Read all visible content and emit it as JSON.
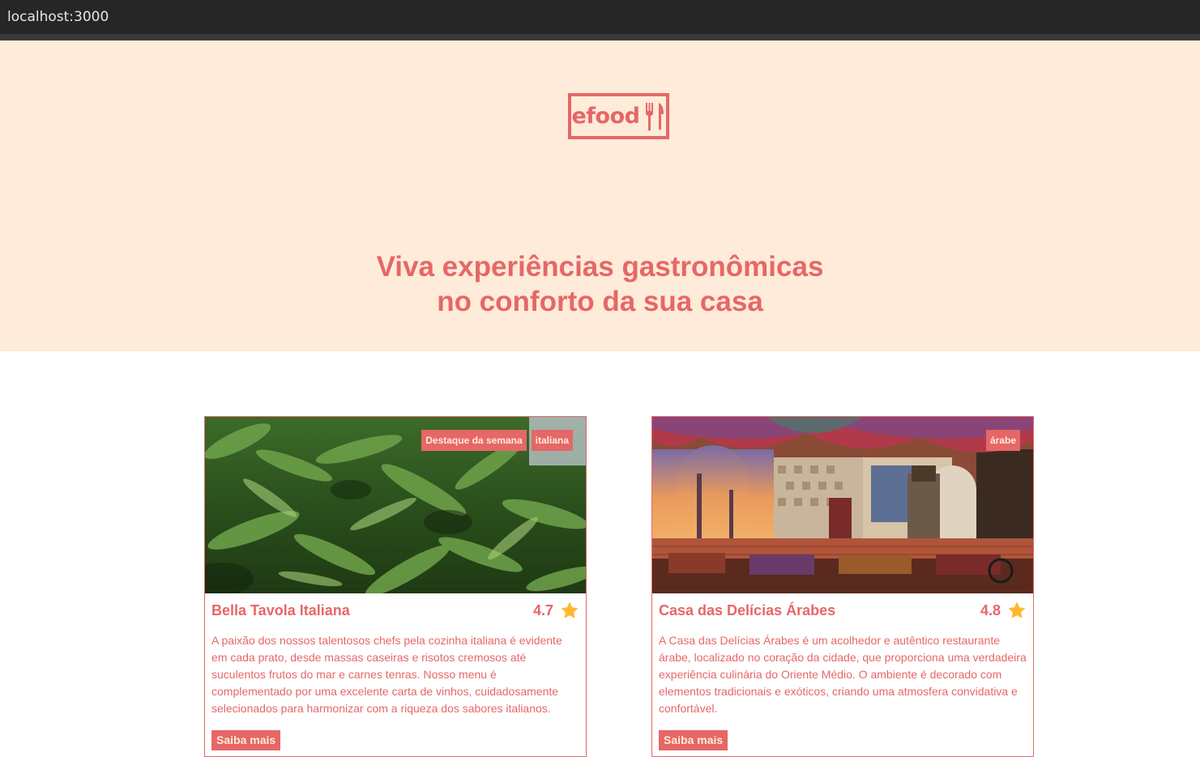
{
  "browser": {
    "url": "localhost:3000"
  },
  "header": {
    "logo_text": "efood",
    "title_line1": "Viva experiências gastronômicas",
    "title_line2": "no conforto da sua casa"
  },
  "colors": {
    "primary": "#e66767",
    "hero_bg": "#ffebd9",
    "tag_text": "#ffebd9",
    "star": "#ffb930"
  },
  "restaurants": [
    {
      "name": "Bella Tavola Italiana",
      "rating": "4.7",
      "tags": [
        "Destaque da semana",
        "italiana"
      ],
      "description": "A paixão dos nossos talentosos chefs pela cozinha italiana é evidente em cada prato, desde massas caseiras e risotos cremosos até suculentos frutos do mar e carnes tenras. Nosso menu é complementado por uma excelente carta de vinhos, cuidadosamente selecionados para harmonizar com a riqueza dos sabores italianos.",
      "button_label": "Saiba mais",
      "image_icon": "fern-foliage-photo"
    },
    {
      "name": "Casa das Delícias Árabes",
      "rating": "4.8",
      "tags": [
        "árabe"
      ],
      "description": "A Casa das Delícias Árabes é um acolhedor e autêntico restaurante árabe, localizado no coração da cidade, que proporciona uma verdadeira experiência culinária do Oriente Médio. O ambiente é decorado com elementos tradicionais e exóticos, criando uma atmosfera convidativa e confortável.",
      "button_label": "Saiba mais",
      "image_icon": "arabic-interior-photo"
    }
  ]
}
